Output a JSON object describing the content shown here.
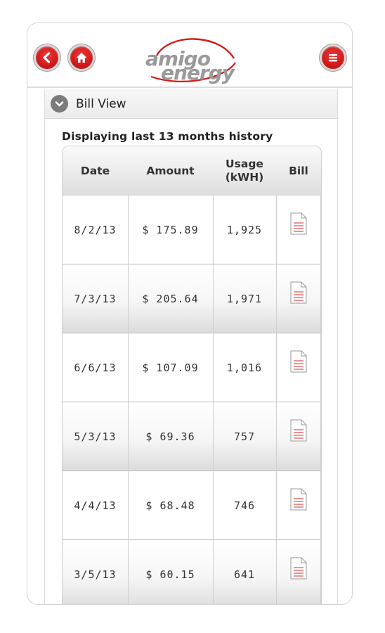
{
  "header": {
    "logo_text_top": "amigo",
    "logo_text_bottom": "energy"
  },
  "section": {
    "title": "Bill View"
  },
  "history_label": "Displaying last 13 months history",
  "table": {
    "headers": {
      "date": "Date",
      "amount": "Amount",
      "usage_line1": "Usage",
      "usage_line2": "(kWH)",
      "bill": "Bill"
    },
    "rows": [
      {
        "date": "8/2/13",
        "amount": "$ 175.89",
        "usage": "1,925"
      },
      {
        "date": "7/3/13",
        "amount": "$ 205.64",
        "usage": "1,971"
      },
      {
        "date": "6/6/13",
        "amount": "$ 107.09",
        "usage": "1,016"
      },
      {
        "date": "5/3/13",
        "amount": "$ 69.36",
        "usage": "757"
      },
      {
        "date": "4/4/13",
        "amount": "$ 68.48",
        "usage": "746"
      },
      {
        "date": "3/5/13",
        "amount": "$ 60.15",
        "usage": "641"
      }
    ]
  },
  "colors": {
    "brand_red": "#d51919",
    "logo_gray": "#9a9a9a"
  }
}
